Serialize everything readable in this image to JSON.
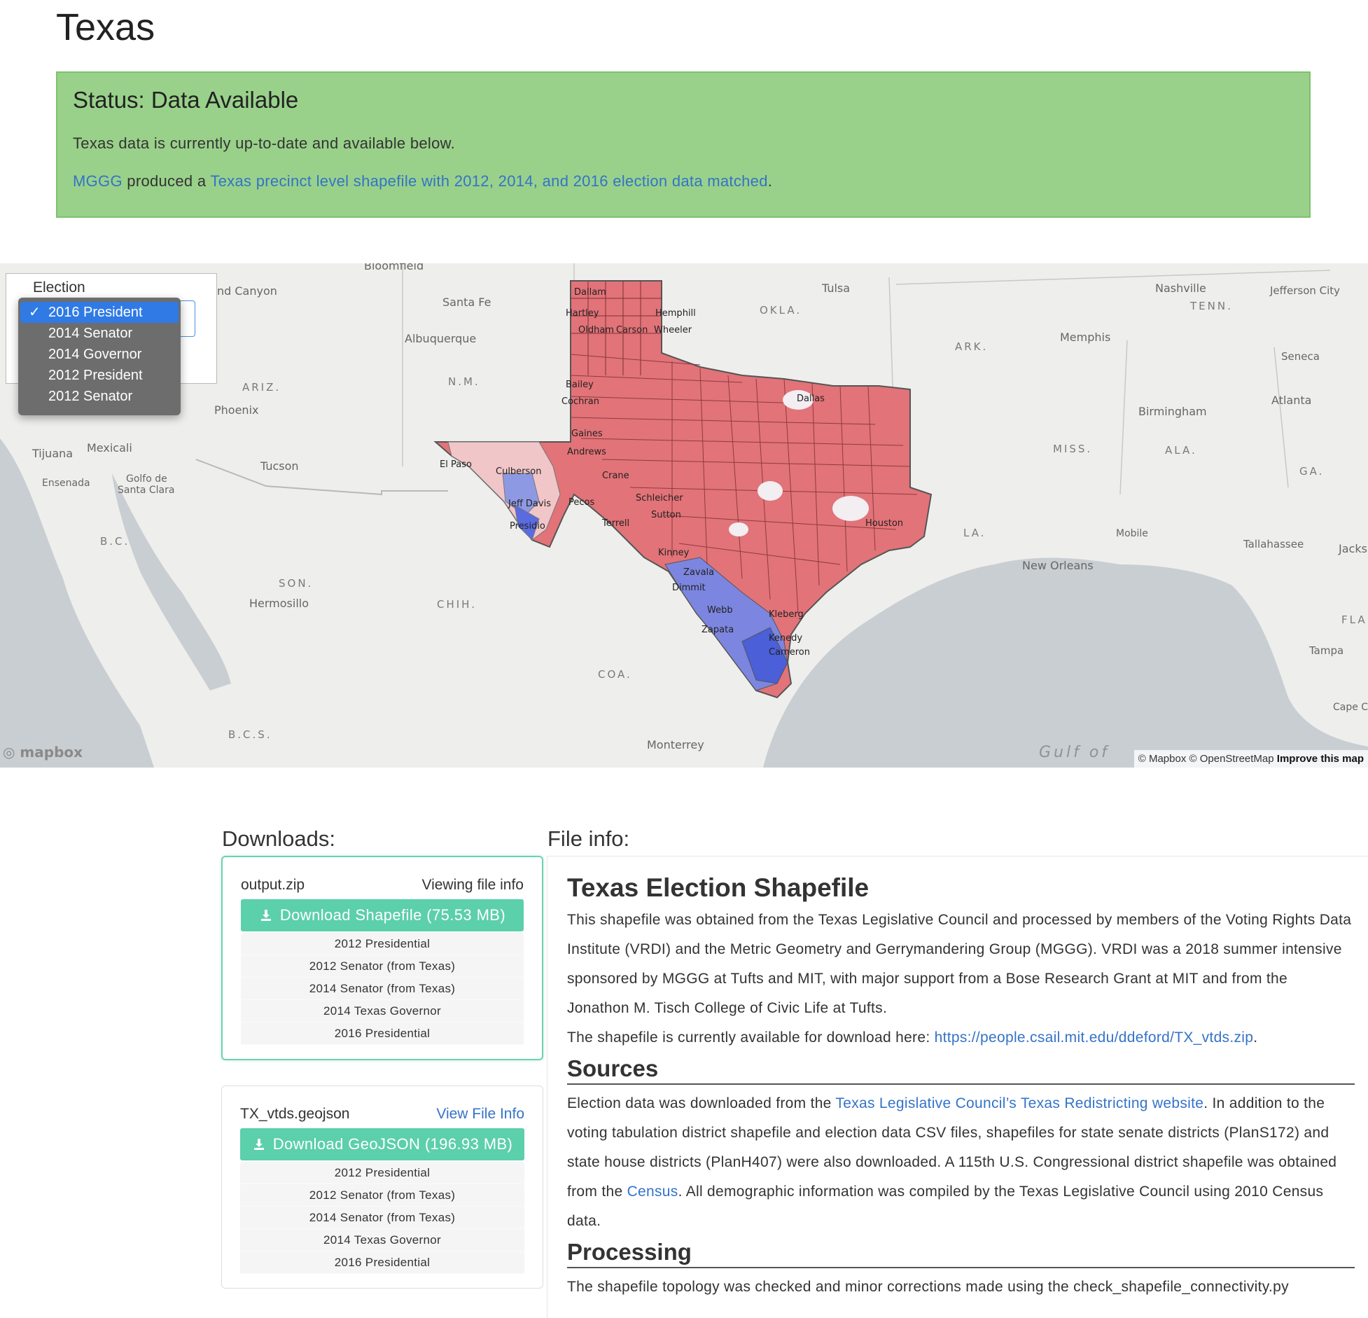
{
  "page": {
    "title": "Texas"
  },
  "status": {
    "title": "Status: Data Available",
    "text": "Texas data is currently up-to-date and available below.",
    "org_link": "MGGG",
    "produced_text": " produced a ",
    "shapefile_link": "Texas precinct level shapefile with 2012, 2014, and 2016 election data matched",
    "end_period": "."
  },
  "map": {
    "election_label": "Election",
    "options": [
      "2016 President",
      "2014 Senator",
      "2014 Governor",
      "2012 President",
      "2012 Senator"
    ],
    "selected": "2016 President",
    "logo": "mapbox",
    "attribution": "© Mapbox © OpenStreetMap",
    "improve_link": "Improve this map",
    "labels": {
      "grand_canyon": "nd Canyon",
      "santa_fe": "Santa Fe",
      "albuquerque": "Albuquerque",
      "nm": "N.M.",
      "ariz": "ARIZ.",
      "phoenix": "Phoenix",
      "tucson": "Tucson",
      "tijuana": "Tijuana",
      "mexicali": "Mexicali",
      "ensenada": "Ensenada",
      "golfo": "Golfo de",
      "santa_clara": "Santa Clara",
      "bc": "B.C.",
      "son": "SON.",
      "hermosillo": "Hermosillo",
      "chih": "CHIH.",
      "coa": "COA.",
      "monterrey": "Monterrey",
      "bcs": "B.C.S.",
      "gulf": "Gulf of",
      "tulsa": "Tulsa",
      "okla": "OKLA.",
      "ark": "ARK.",
      "memphis": "Memphis",
      "nashville": "Nashville",
      "tenn": "TENN.",
      "jefferson": "Jefferson City",
      "seneca": "Seneca",
      "birmingham": "Birmingham",
      "atlanta": "Atlanta",
      "miss": "MISS.",
      "ala": "ALA.",
      "ga": "GA.",
      "la": "LA.",
      "mobile": "Mobile",
      "tallahassee": "Tallahassee",
      "jacks": "Jacks",
      "new_orleans": "New Orleans",
      "fla": "FLA",
      "tampa": "Tampa",
      "cape": "Cape C",
      "bloomfield": "Bloomfield",
      "dallam": "Dallam",
      "hartley": "Hartley",
      "hemphill": "Hemphill",
      "oldham": "Oldham",
      "carson": "Carson",
      "wheeler": "Wheeler",
      "bailey": "Bailey",
      "cochran": "Cochran",
      "gaines": "Gaines",
      "andrews": "Andrews",
      "el_paso": "El Paso",
      "culberson": "Culberson",
      "jeff_davis": "Jeff Davis",
      "presidio": "Presidio",
      "pecos": "Pecos",
      "crane": "Crane",
      "schleicher": "Schleicher",
      "sutton": "Sutton",
      "terrell": "Terrell",
      "kinney": "Kinney",
      "zavala": "Zavala",
      "dimmit": "Dimmit",
      "webb": "Webb",
      "zapata": "Zapata",
      "kleberg": "Kleberg",
      "kenedy": "Kenedy",
      "cameron": "Cameron",
      "dallas": "Dallas",
      "houston": "Houston"
    }
  },
  "downloads": {
    "heading": "Downloads:",
    "cards": [
      {
        "filename": "output.zip",
        "link_text": "Viewing file info",
        "button_label": "Download Shapefile (75.53 MB)",
        "files": [
          "2012 Presidential",
          "2012 Senator (from Texas)",
          "2014 Senator (from Texas)",
          "2014 Texas Governor",
          "2016 Presidential"
        ]
      },
      {
        "filename": "TX_vtds.geojson",
        "link_text": "View File Info",
        "button_label": "Download GeoJSON (196.93 MB)",
        "files": [
          "2012 Presidential",
          "2012 Senator (from Texas)",
          "2014 Senator (from Texas)",
          "2014 Texas Governor",
          "2016 Presidential"
        ]
      }
    ]
  },
  "file_info": {
    "heading": "File info:",
    "title": "Texas Election Shapefile",
    "intro": "This shapefile was obtained from the Texas Legislative Council and processed by members of the Voting Rights Data Institute (VRDI) and the Metric Geometry and Gerrymandering Group (MGGG). VRDI was a 2018 summer intensive sponsored by MGGG at Tufts and MIT, with major support from a Bose Research Grant at MIT and from the Jonathon M. Tisch College of Civic Life at Tufts.",
    "available_text": "The shapefile is currently available for download here: ",
    "available_link": "https://people.csail.mit.edu/ddeford/TX_vtds.zip",
    "available_end": ".",
    "sources_heading": "Sources",
    "sources_pre": "Election data was downloaded from the ",
    "sources_link": "Texas Legislative Council’s Texas Redistricting website",
    "sources_mid": ". In addition to the voting tabulation district shapefile and election data CSV files, shapefiles for state senate districts (PlanS172) and state house districts (PlanH407) were also downloaded. A 115th U.S. Congressional district shapefile was obtained from the ",
    "census_link": "Census",
    "sources_end": ". All demographic information was compiled by the Texas Legislative Council using 2010 Census data.",
    "processing_heading": "Processing",
    "processing_text": "The shapefile topology was checked and minor corrections made using the check_shapefile_connectivity.py"
  },
  "colors": {
    "accent": "#5ccfab",
    "status_bg": "#99d18a",
    "link": "#3473c8",
    "republican": "#e0565c",
    "democrat": "#4a5fd8"
  }
}
